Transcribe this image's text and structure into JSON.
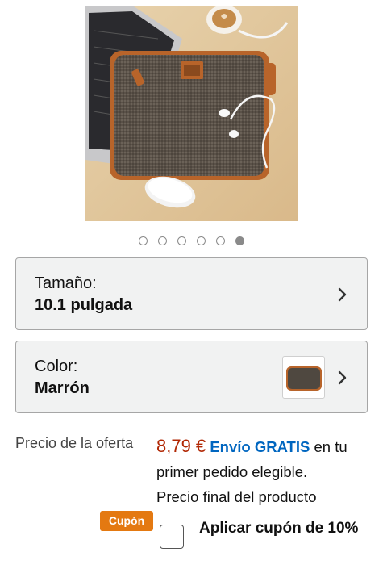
{
  "product": {
    "image_name": "laptop-sleeve-product-image",
    "image_count": 6,
    "active_image_index": 5
  },
  "size_selector": {
    "label": "Tamaño:",
    "value": "10.1 pulgada",
    "icon": "chevron-right-icon"
  },
  "color_selector": {
    "label": "Color:",
    "value": "Marrón",
    "icon": "chevron-right-icon"
  },
  "price": {
    "label": "Precio de la oferta",
    "value": "8,79 €",
    "shipping": "Envío GRATIS",
    "shipping_suffix": "en tu primer pedido elegible.",
    "note": "Precio final del producto"
  },
  "coupon": {
    "badge": "Cupón",
    "label": "Aplicar cupón de 10%",
    "checked": false
  },
  "colors": {
    "price": "#b12704",
    "link": "#0066c0",
    "coupon_badge": "#e47911",
    "selector_bg": "#f1f2f2"
  }
}
